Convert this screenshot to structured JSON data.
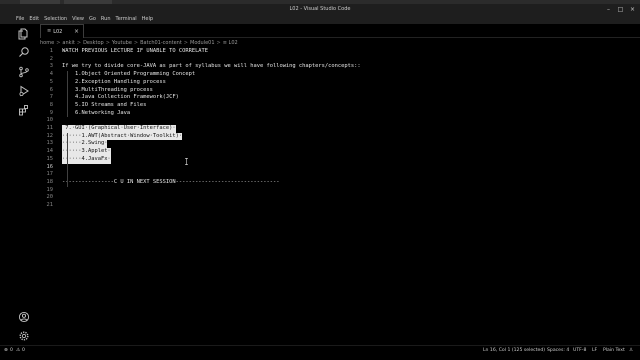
{
  "window": {
    "title": "L02 - Visual Studio Code"
  },
  "menu": {
    "items": [
      "File",
      "Edit",
      "Selection",
      "View",
      "Go",
      "Run",
      "Terminal",
      "Help"
    ]
  },
  "activity_bar": {
    "icons": [
      "files-icon",
      "search-icon",
      "source-control-icon",
      "run-debug-icon",
      "extensions-icon",
      "account-icon",
      "settings-gear-icon"
    ]
  },
  "tab": {
    "label": "L02",
    "icon": "≡",
    "close": "×"
  },
  "breadcrumb": {
    "items": [
      "home",
      "ankit",
      "Desktop",
      "Youtube",
      "Batch01-content",
      "Module01",
      "≡ L02"
    ],
    "separator": ">"
  },
  "editor": {
    "lines": [
      {
        "num": "1",
        "text": "WATCH PREVIOUS LECTURE IF UNABLE TO CORRELATE"
      },
      {
        "num": "2",
        "text": ""
      },
      {
        "num": "3",
        "text": "If we try to divide core-JAVA as part of syllabus we will have following chapters/concepts::"
      },
      {
        "num": "4",
        "text": "    1.Object Oriented Programming Concept"
      },
      {
        "num": "5",
        "text": "    2.Exception Handling process"
      },
      {
        "num": "6",
        "text": "    3.MultiThreading process"
      },
      {
        "num": "7",
        "text": "    4.Java Collection Framework(JCF)"
      },
      {
        "num": "8",
        "text": "    5.IO Streams and Files"
      },
      {
        "num": "9",
        "text": "    6.Networking Java"
      },
      {
        "num": "10",
        "text": ""
      },
      {
        "num": "11",
        "text": " 7.·GUI·(Graphical·User·Interface)·"
      },
      {
        "num": "12",
        "text": "······1.AWT(Abstract·Window·Toolkit)·"
      },
      {
        "num": "13",
        "text": "······2.Swing·"
      },
      {
        "num": "14",
        "text": "······3.Applet·"
      },
      {
        "num": "15",
        "text": "······4.JavaFx·"
      },
      {
        "num": "16",
        "text": ""
      },
      {
        "num": "17",
        "text": ""
      },
      {
        "num": "18",
        "text": "----------------C U IN NEXT SESSION--------------------------------"
      },
      {
        "num": "19",
        "text": ""
      },
      {
        "num": "20",
        "text": ""
      },
      {
        "num": "21",
        "text": ""
      }
    ],
    "current_line": "16"
  },
  "status": {
    "errors": "0",
    "warnings": "0",
    "position": "Ln 16, Col 1 (125 selected)",
    "spaces": "Spaces: 4",
    "encoding": "UTF-8",
    "eol": "LF",
    "language": "Plain Text"
  },
  "colors": {
    "background": "#000000",
    "selection": "#e8e8e8",
    "line_number": "#858585",
    "current_line_number": "#c6c6c6",
    "text": "#e6e6e6"
  }
}
